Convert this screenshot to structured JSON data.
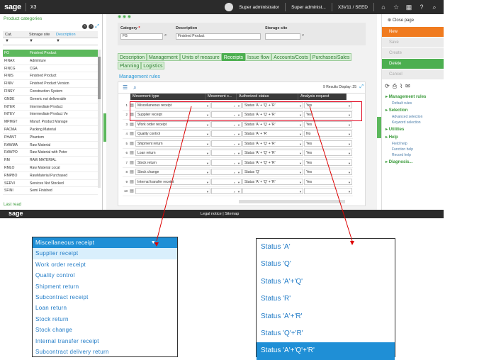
{
  "topbar": {
    "logo": "sage",
    "app": "X3",
    "user": "Super administrator",
    "user_short": "Super administ...",
    "folder": "X3V11 / SEED",
    "icons": [
      "home-icon",
      "star-icon",
      "grid-icon",
      "help-icon",
      "search-icon"
    ]
  },
  "left_panel": {
    "title": "Product categories",
    "columns": [
      "Cat.",
      "Storage site",
      "Description"
    ],
    "rows": [
      {
        "code": "FG",
        "desc": "Finished Product"
      },
      {
        "code": "FINAX",
        "desc": "Adminture"
      },
      {
        "code": "FINCG",
        "desc": "CGA"
      },
      {
        "code": "FINIS",
        "desc": "Finished Product"
      },
      {
        "code": "FINIV",
        "desc": "Finished Product Version"
      },
      {
        "code": "FINSY",
        "desc": "Construction System"
      },
      {
        "code": "GNDE",
        "desc": "Generic not deliverable"
      },
      {
        "code": "INTER",
        "desc": "Intermediate Product"
      },
      {
        "code": "INTEV",
        "desc": "Intermediate Product Ve"
      },
      {
        "code": "MPMGT",
        "desc": "Manuf. Product Manage"
      },
      {
        "code": "PACMA",
        "desc": "Packing Material"
      },
      {
        "code": "PHANT",
        "desc": "Phantom"
      },
      {
        "code": "RAWMA",
        "desc": "Raw Material"
      },
      {
        "code": "RAWPO",
        "desc": "Raw Material with Poter"
      },
      {
        "code": "RM",
        "desc": "RAW MATERIAL"
      },
      {
        "code": "RMLO",
        "desc": "Raw Material Local"
      },
      {
        "code": "RMPBO",
        "desc": "RawMaterial Purchased"
      },
      {
        "code": "SERVI",
        "desc": "Services Not Stocked"
      },
      {
        "code": "SFINI",
        "desc": "Semi Finished"
      }
    ],
    "last_read": "Last read"
  },
  "form": {
    "category_label": "Category",
    "category_value": "FG",
    "description_label": "Description",
    "description_value": "Finished Product",
    "storage_label": "Storage site",
    "storage_value": ""
  },
  "tabs": [
    "Description",
    "Management",
    "Units of measure",
    "Receipts",
    "Issue flow",
    "Accounts/Costs",
    "Purchases/Sales",
    "Planning",
    "Logistics"
  ],
  "active_tab": "Receipts",
  "section_title": "Management rules",
  "grid": {
    "results": "9 Results  Display: 25",
    "columns": [
      "Movement type",
      "Movement c...",
      "Authorized status",
      "Analysis request"
    ],
    "rows": [
      {
        "n": "1",
        "type": "Miscellaneous receipt",
        "status": "Status 'A' + 'Q' + 'R'",
        "analysis": "Yes"
      },
      {
        "n": "2",
        "type": "Supplier receipt",
        "status": "Status 'A' + 'Q' + 'R'",
        "analysis": "Yes"
      },
      {
        "n": "3",
        "type": "Work order receipt",
        "status": "Status 'A' + 'Q' + 'R'",
        "analysis": "Yes"
      },
      {
        "n": "4",
        "type": "Quality control",
        "status": "Status 'A' + 'R'",
        "analysis": "No"
      },
      {
        "n": "5",
        "type": "Shipment return",
        "status": "Status 'A' + 'Q' + 'R'",
        "analysis": "Yes"
      },
      {
        "n": "6",
        "type": "Loan return",
        "status": "Status 'A' + 'Q' + 'R'",
        "analysis": "Yes"
      },
      {
        "n": "7",
        "type": "Stock return",
        "status": "Status 'A' + 'Q' + 'R'",
        "analysis": "Yes"
      },
      {
        "n": "8",
        "type": "Stock change",
        "status": "Status 'Q'",
        "analysis": "Yes"
      },
      {
        "n": "9",
        "type": "Internal transfer receipt",
        "status": "Status 'A' + 'Q' + 'R'",
        "analysis": "Yes"
      },
      {
        "n": "10",
        "type": "",
        "status": "",
        "analysis": ""
      }
    ]
  },
  "right_panel": {
    "close": "Close page",
    "buttons": [
      "New",
      "Save",
      "Create",
      "Delete",
      "Cancel"
    ],
    "sections": [
      {
        "title": "Management rules",
        "links": [
          "Default rules"
        ]
      },
      {
        "title": "Selection",
        "links": [
          "Advanced selection",
          "Keyword selection"
        ]
      },
      {
        "title": "Utilities",
        "links": []
      },
      {
        "title": "Help",
        "links": [
          "Field help",
          "Function help",
          "Record help"
        ]
      },
      {
        "title": "Diagnosis...",
        "links": []
      }
    ]
  },
  "footer": {
    "logo": "sage",
    "links": "Legal notice  |  Sitemap"
  },
  "movement_dropdown": [
    "Miscellaneous receipt",
    "Supplier receipt",
    "Work order receipt",
    "Quality control",
    "Shipment return",
    "Subcontract receipt",
    "Loan return",
    "Stock return",
    "Stock change",
    "Internal transfer receipt",
    "Subcontract delivery return"
  ],
  "status_dropdown": [
    "Status 'A'",
    "Status 'Q'",
    "Status 'A'+'Q'",
    "Status 'R'",
    "Status 'A'+'R'",
    "Status 'Q'+'R'",
    "Status 'A'+'Q'+'R'"
  ],
  "colors": {
    "accent_green": "#4caf50",
    "orange": "#f07b1f",
    "blue": "#1f8fd6",
    "highlight_red": "#e0001a"
  }
}
